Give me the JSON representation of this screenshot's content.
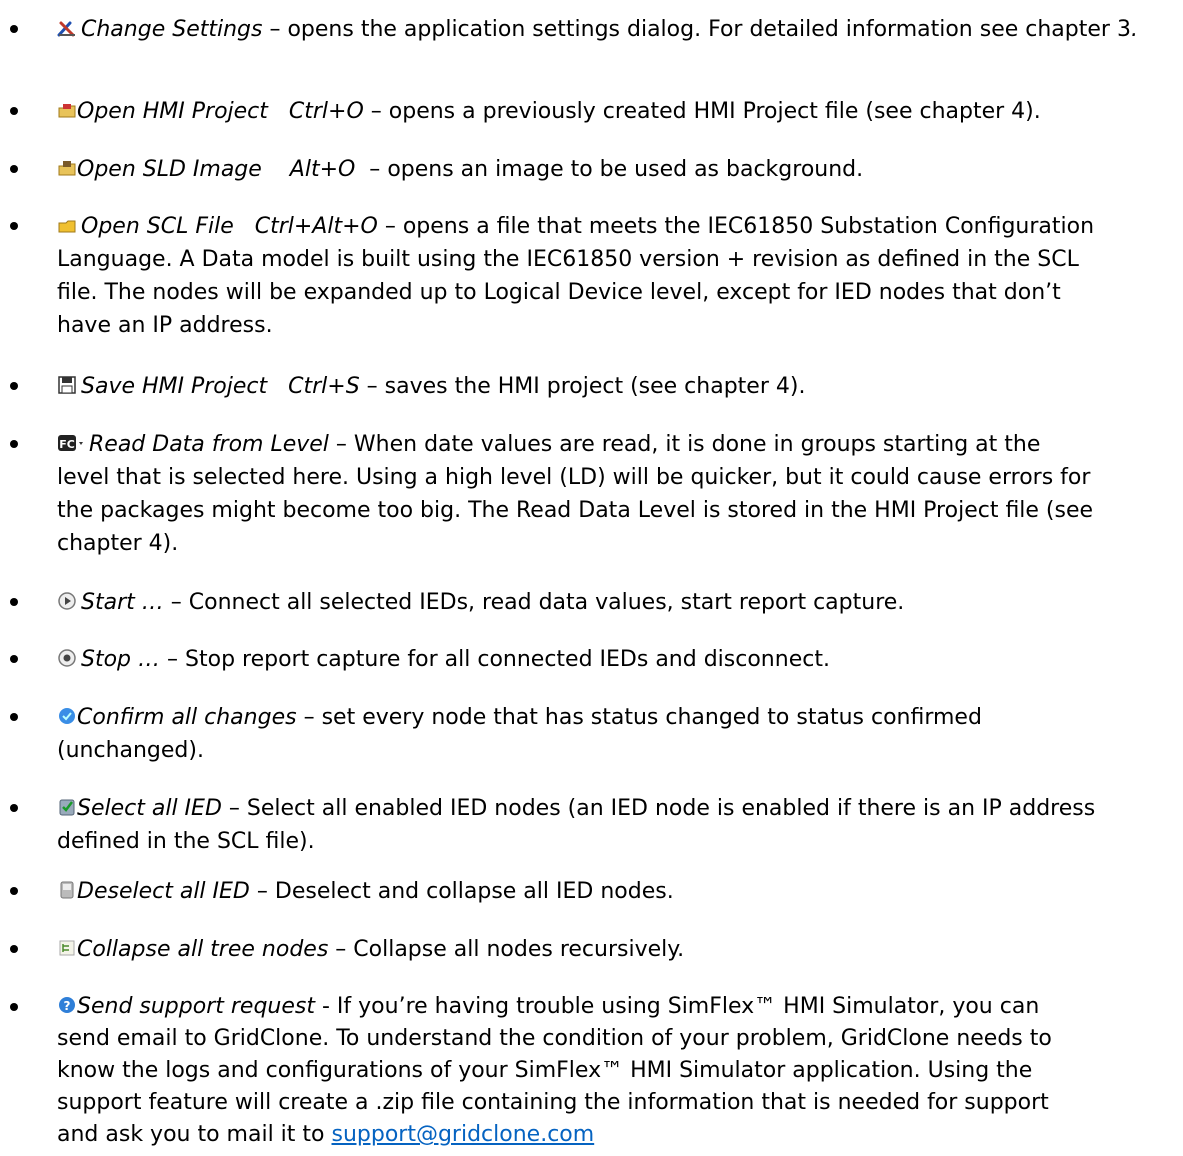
{
  "items": [
    {
      "icon": "settings-tools-icon",
      "title": "Change Settings",
      "sep": " – ",
      "desc_before": "opens the application settings dialog. For detailed information see chapter 3",
      "desc_ital_tail": "."
    },
    {
      "icon": "open-hmi-project-icon",
      "title": "Open HMI Project   Ctrl+O",
      "sep": " – ",
      "desc": "opens a previously created HMI Project file (see chapter 4)."
    },
    {
      "icon": "open-sld-image-icon",
      "title": "Open SLD Image    Alt+O ",
      "sep": " – ",
      "desc": "opens an image to be used as background."
    },
    {
      "icon": "open-scl-file-icon",
      "title": "Open SCL File   Ctrl+Alt+O",
      "sep": " – ",
      "desc_lines": [
        "opens a file that meets the IEC61850 Substation Configuration",
        "Language. A Data model is built using the IEC61850 version + revision as defined in the SCL",
        "file. The nodes will be expanded up to Logical Device level, except for IED nodes that don’t",
        "have an IP address."
      ]
    },
    {
      "icon": "save-disk-icon",
      "title": "Save HMI Project   Ctrl+S",
      "sep": " – ",
      "desc": "saves the HMI project (see chapter 4)."
    },
    {
      "icon": "fc-level-dropdown-icon",
      "title": "Read Data from Level",
      "sep": " – ",
      "desc_lines": [
        "When date values are read, it is done in groups starting at the",
        "level that is selected here. Using a high level (LD) will be quicker, but it could cause errors for",
        "the packages might become too big. The Read Data Level is stored in the HMI Project file (see",
        "chapter 4)."
      ]
    },
    {
      "icon": "start-play-icon",
      "title": "Start …",
      "sep": " – ",
      "desc": "Connect all selected IEDs, read data values, start report capture."
    },
    {
      "icon": "stop-icon",
      "title": "Stop …",
      "sep": " – ",
      "desc": "Stop report capture for all connected IEDs and disconnect."
    },
    {
      "icon": "confirm-changes-icon",
      "title": "Confirm all changes",
      "sep": " – ",
      "desc_lines": [
        "set every node that has status changed to status confirmed",
        "(unchanged)."
      ]
    },
    {
      "icon": "select-all-ied-icon",
      "title": "Select all IED",
      "sep": " – ",
      "desc_lines": [
        "Select all enabled IED nodes (an IED node is enabled if there is an IP address",
        "defined in the SCL file)."
      ]
    },
    {
      "icon": "deselect-all-ied-icon",
      "title": "Deselect all IED",
      "sep": " – ",
      "desc": "Deselect and collapse all IED nodes."
    },
    {
      "icon": "collapse-tree-icon",
      "title": "Collapse all tree nodes",
      "sep": " – ",
      "desc": "Collapse all nodes recursively."
    },
    {
      "icon": "support-request-icon",
      "title": "Send support request",
      "sep": " - ",
      "desc_lines": [
        "If you’re having trouble using SimFlex™ HMI Simulator, you can",
        "send email to GridClone. To understand the condition of your problem, GridClone needs to",
        "know the logs and configurations of your SimFlex™ HMI Simulator application. Using the",
        "support feature will create a .zip file containing the information that is needed for support",
        "and ask you to mail it to "
      ],
      "link": "support@gridclone.com"
    }
  ]
}
